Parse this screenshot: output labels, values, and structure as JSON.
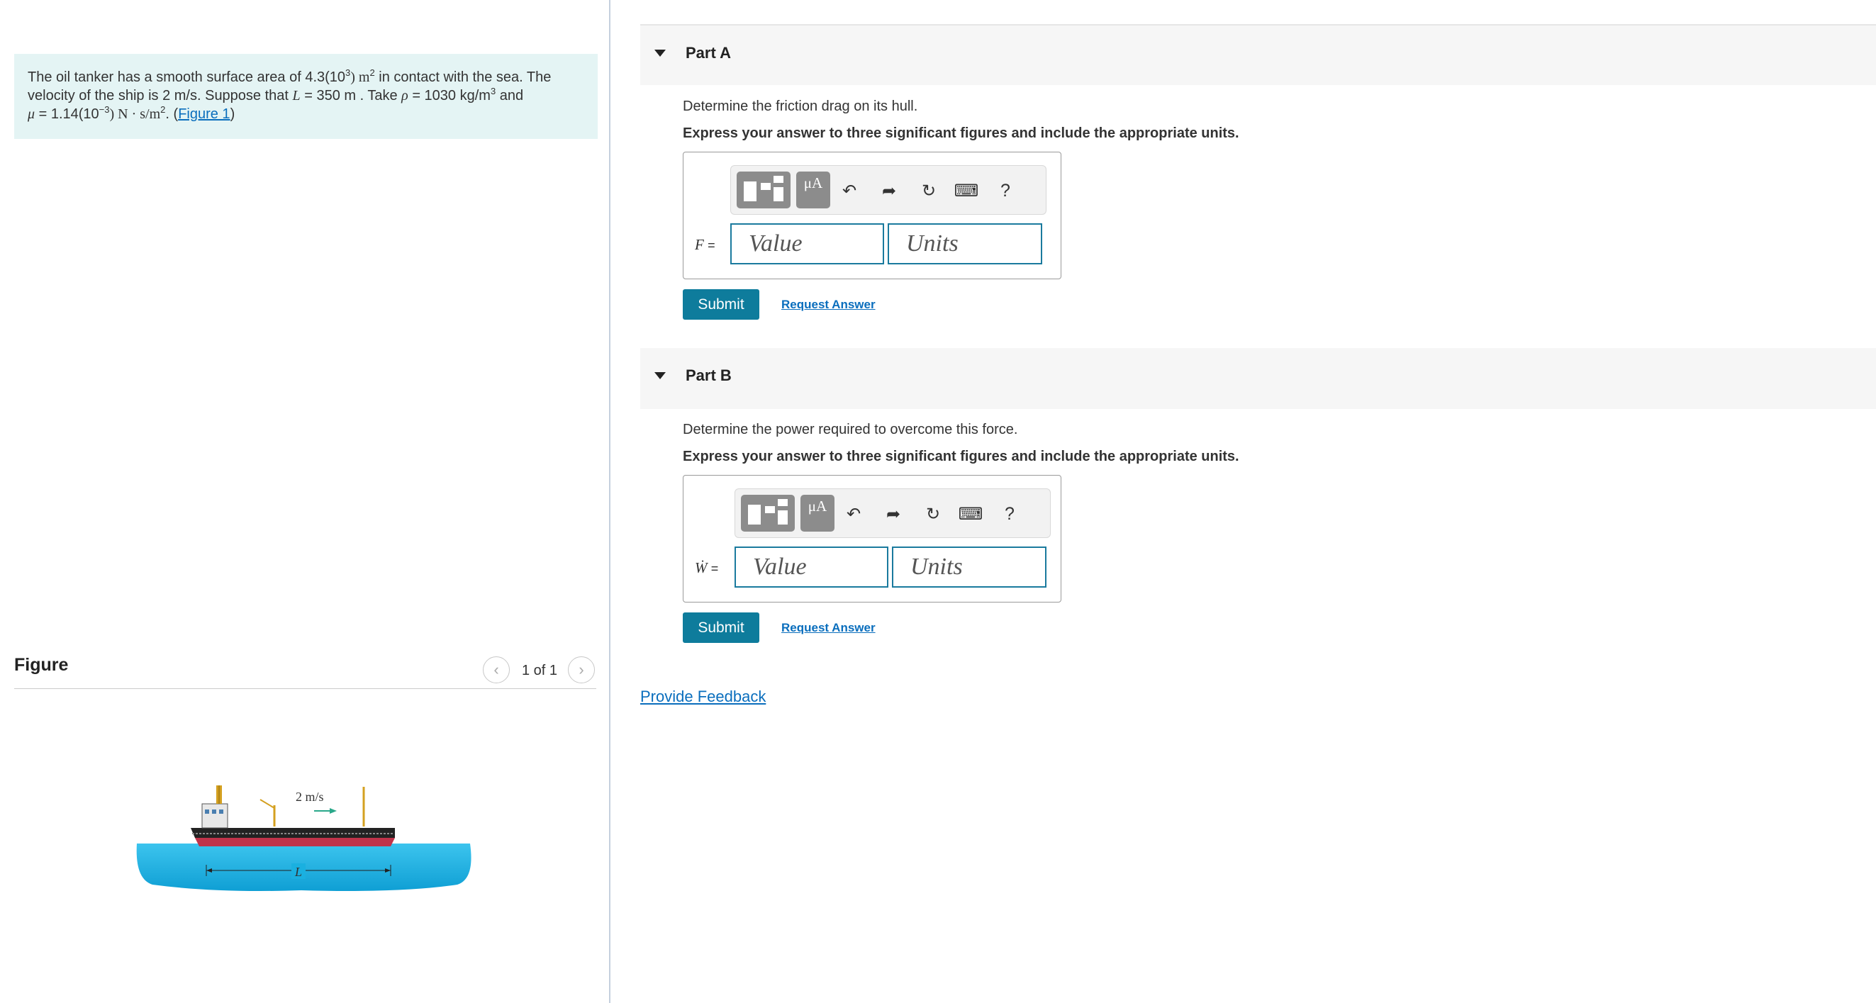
{
  "problem": {
    "t1": "The oil tanker has a smooth surface area of 4.3(10",
    "t1_exp": "3",
    "t2": ") m",
    "t2_exp": "2",
    "t3": " in contact with the sea. The",
    "t4": "velocity of the ship is 2 m/s. Suppose that ",
    "t4_var": "L",
    "t5": " = 350  m . Take ",
    "t5_var": "ρ",
    "t6": " = 1030 kg/m",
    "t6_exp": "3",
    "t7": " and",
    "t8_var": "μ",
    "t8": " = 1.14(10",
    "t8_exp": "−3",
    "t9": ") N · s/m",
    "t9_exp": "2",
    "t10": ". (",
    "figure_link": "Figure 1",
    "t11": ")"
  },
  "figure": {
    "title": "Figure",
    "pager": "1 of 1",
    "prev_icon": "chevron-left-icon",
    "next_icon": "chevron-right-icon",
    "velocity_label": "2 m/s",
    "length_label": "L"
  },
  "toolbar": {
    "units_label": "μA",
    "icons": [
      "templates-icon",
      "units-icon",
      "undo-icon",
      "redo-icon",
      "reset-icon",
      "keyboard-icon",
      "help-icon"
    ],
    "help_label": "?"
  },
  "part_a": {
    "title": "Part A",
    "question": "Determine the friction drag on its hull.",
    "instruction": "Express your answer to three significant figures and include the appropriate units.",
    "variable": "F",
    "equals": "=",
    "value_placeholder": "Value",
    "units_placeholder": "Units",
    "submit": "Submit",
    "request": "Request Answer"
  },
  "part_b": {
    "title": "Part B",
    "question": "Determine the power required to overcome this force.",
    "instruction": "Express your answer to three significant figures and include the appropriate units.",
    "variable": "Ẇ",
    "equals": "=",
    "value_placeholder": "Value",
    "units_placeholder": "Units",
    "submit": "Submit",
    "request": "Request Answer"
  },
  "feedback": "Provide Feedback",
  "colors": {
    "accent": "#0e7c9c",
    "link": "#0a6ebd",
    "problem_bg": "#e4f4f4",
    "water": "#1ab0e0"
  }
}
